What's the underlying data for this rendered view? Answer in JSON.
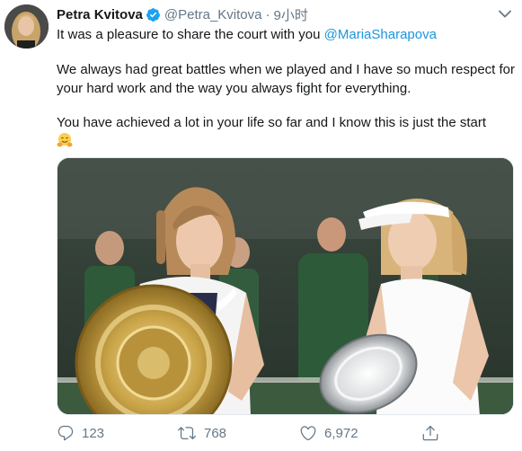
{
  "tweet": {
    "author_name": "Petra Kvitova",
    "author_handle": "@Petra_Kvitova",
    "separator": "·",
    "timestamp": "9小时",
    "line1_prefix": "It was a pleasure to share the court with you ",
    "line1_mention": "@MariaSharapova",
    "paragraph2": "We always had great battles when we played and I have so much respect for your hard work and the way you always fight for everything.",
    "paragraph3": "You have achieved a lot in your life so far and I know this is just the start",
    "emoji": "hugging-face",
    "media_description_icon": "tennis-trophy-photo"
  },
  "actions": {
    "reply_count": "123",
    "retweet_count": "768",
    "like_count": "6,972"
  },
  "colors": {
    "link": "#1b95e0",
    "muted": "#657786",
    "verified": "#1da1f2"
  }
}
